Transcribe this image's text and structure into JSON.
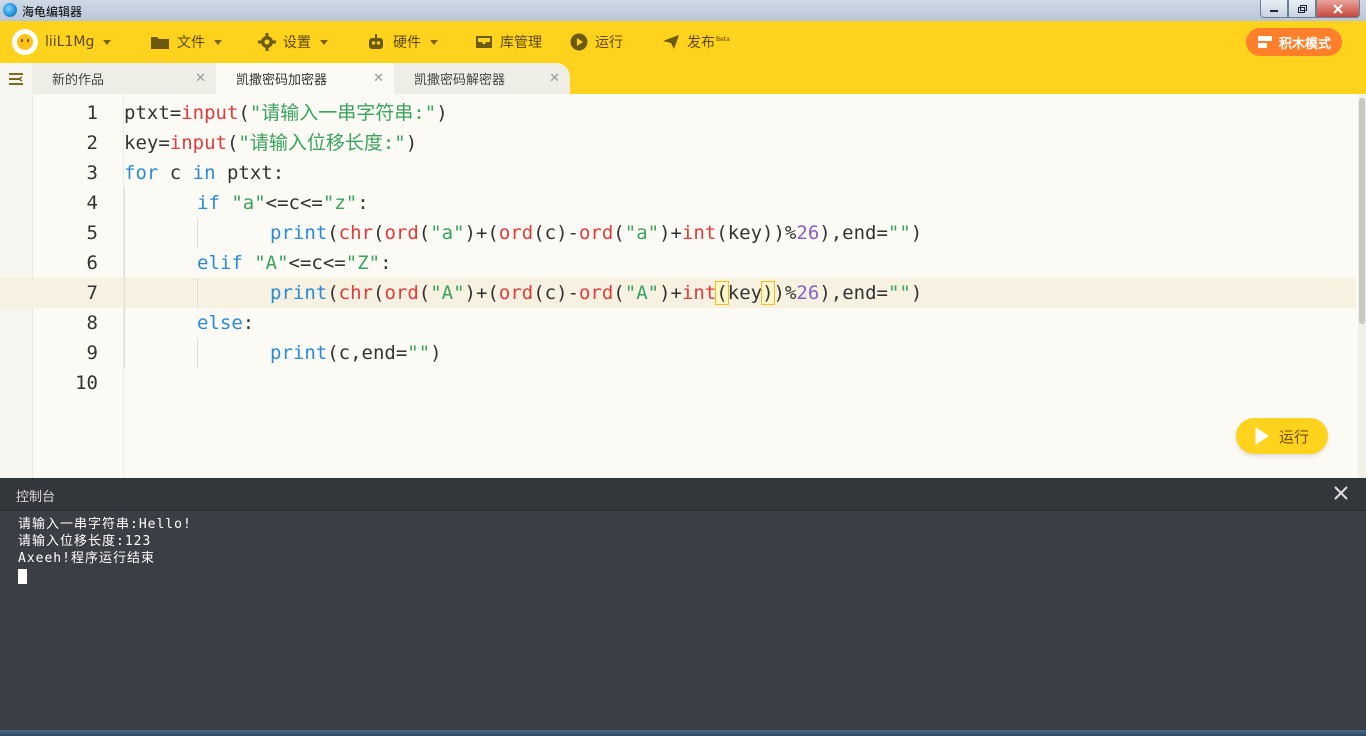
{
  "window": {
    "title": "海龟编辑器"
  },
  "toolbar": {
    "user": "liiL1Mg",
    "file": "文件",
    "settings": "设置",
    "hardware": "硬件",
    "library": "库管理",
    "run": "运行",
    "publish": "发布",
    "publish_badge": "Beta",
    "blocks_mode": "积木模式"
  },
  "tabs": [
    {
      "label": "新的作品",
      "active": false
    },
    {
      "label": "凯撒密码加密器",
      "active": true
    },
    {
      "label": "凯撒密码解密器",
      "active": false
    }
  ],
  "editor": {
    "line_numbers": [
      "1",
      "2",
      "3",
      "4",
      "5",
      "6",
      "7",
      "8",
      "9",
      "10"
    ],
    "current_line": 7,
    "run_button": "运行"
  },
  "code": {
    "l1": {
      "a": "ptxt=",
      "b": "input",
      "c": "(",
      "d": "\"请输入一串字符串:\"",
      "e": ")"
    },
    "l2": {
      "a": "key=",
      "b": "input",
      "c": "(",
      "d": "\"请输入位移长度:\"",
      "e": ")"
    },
    "l3": {
      "a": "for",
      "b": " c ",
      "c": "in",
      "d": " ptxt:"
    },
    "l4": {
      "a": "if",
      "b": " ",
      "c": "\"a\"",
      "d": "<=c<=",
      "e": "\"z\"",
      "f": ":"
    },
    "l5": {
      "a": "print",
      "b": "(",
      "c": "chr",
      "d": "(",
      "e": "ord",
      "f": "(",
      "g": "\"a\"",
      "h": ")+(",
      "i": "ord",
      "j": "(c)-",
      "k": "ord",
      "l": "(",
      "m": "\"a\"",
      "n": ")+",
      "o": "int",
      "p": "(key))%",
      "q": "26",
      "r": "),end=",
      "s": "\"\"",
      "t": ")"
    },
    "l6": {
      "a": "elif",
      "b": " ",
      "c": "\"A\"",
      "d": "<=c<=",
      "e": "\"Z\"",
      "f": ":"
    },
    "l7": {
      "a": "print",
      "b": "(",
      "c": "chr",
      "d": "(",
      "e": "ord",
      "f": "(",
      "g": "\"A\"",
      "h": ")+(",
      "i": "ord",
      "j": "(c)-",
      "k": "ord",
      "l": "(",
      "m": "\"A\"",
      "n": ")+",
      "o": "int",
      "p1": "(",
      "p2": "key",
      "p3": ")",
      "p4": ")%",
      "q": "26",
      "r": "),end=",
      "s": "\"\"",
      "t": ")"
    },
    "l8": {
      "a": "else",
      "b": ":"
    },
    "l9": {
      "a": "print",
      "b": "(c,end=",
      "c": "\"\"",
      "d": ")"
    }
  },
  "console": {
    "title": "控制台",
    "lines": [
      "请输入一串字符串:Hello!",
      "请输入位移长度:123",
      "Axeeh!程序运行结束"
    ]
  },
  "colors": {
    "accent": "#ffd21e",
    "blocks_button": "#ff7f2a",
    "console_bg": "#3b3e44"
  }
}
